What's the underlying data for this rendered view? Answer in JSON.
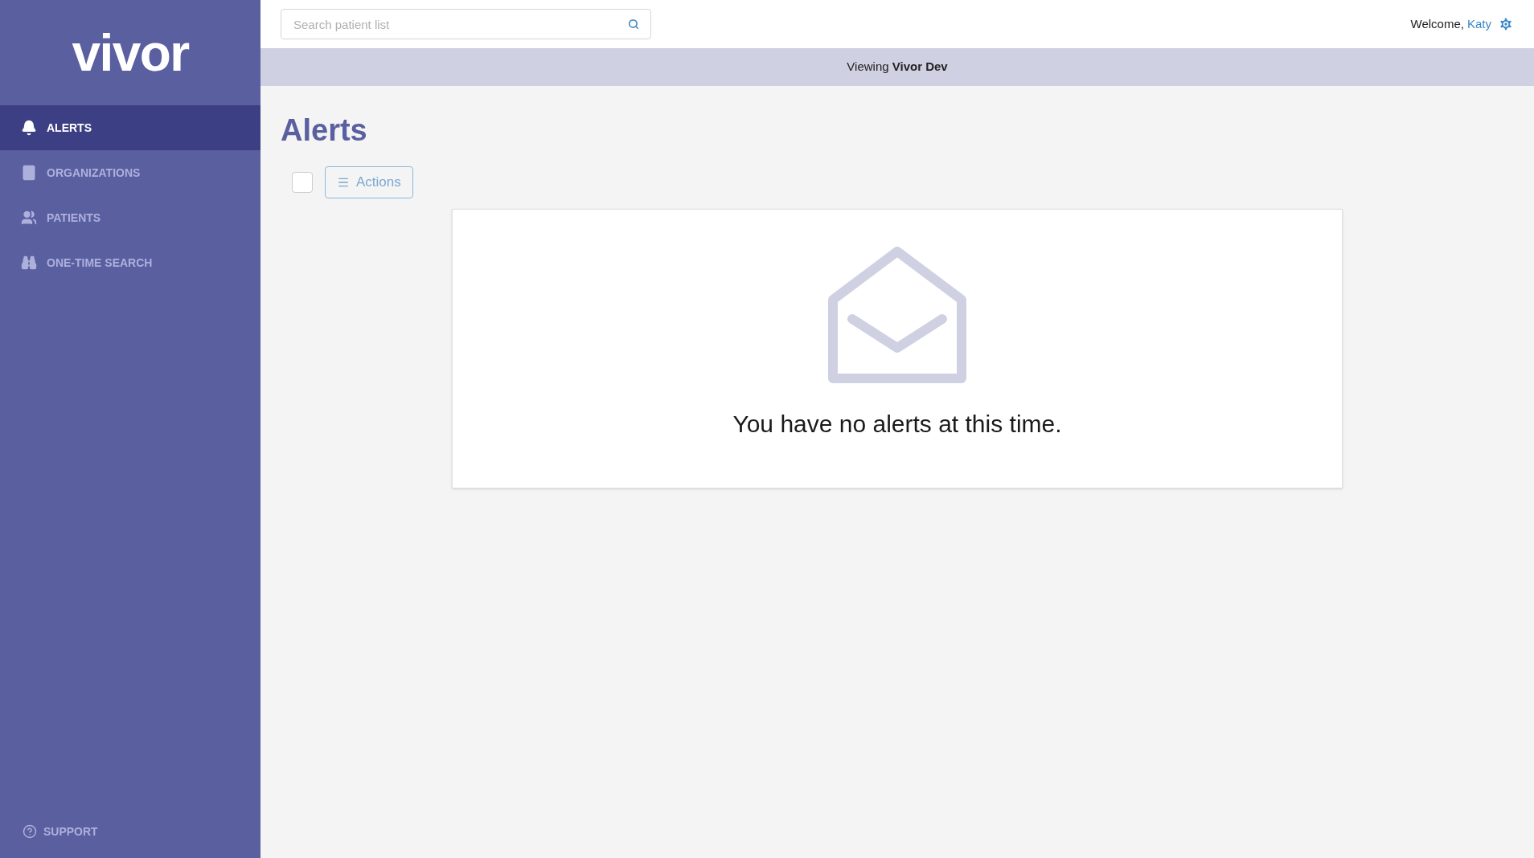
{
  "logo": "vivor",
  "sidebar": {
    "items": [
      {
        "label": "ALERTS",
        "selected": true
      },
      {
        "label": "ORGANIZATIONS",
        "selected": false
      },
      {
        "label": "PATIENTS",
        "selected": false
      },
      {
        "label": "ONE-TIME SEARCH",
        "selected": false
      }
    ],
    "support": "SUPPORT"
  },
  "search": {
    "placeholder": "Search patient list"
  },
  "welcome": {
    "text": "Welcome,",
    "user": "Katy"
  },
  "banner": "Viewing **Vivor Dev**",
  "page_title": "Alerts",
  "toolbar": {
    "select_all_checked": false,
    "actions_label": "Actions"
  },
  "empty_state": "You have no alerts at this time."
}
